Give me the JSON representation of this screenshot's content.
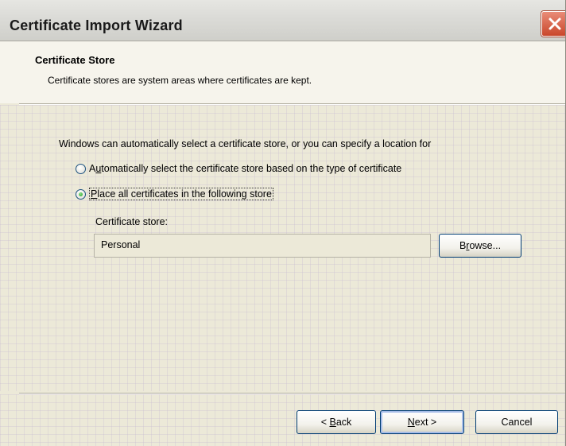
{
  "window": {
    "title": "Certificate Import Wizard",
    "close_icon": "close-x-icon"
  },
  "header": {
    "title": "Certificate Store",
    "description": "Certificate stores are system areas where certificates are kept."
  },
  "main": {
    "instruction": "Windows can automatically select a certificate store, or you can specify a location for",
    "options": [
      {
        "label_prefix": "A",
        "label_mnemonic": "u",
        "label_rest": "tomatically select the certificate store based on the type of certificate",
        "selected": false
      },
      {
        "label_prefix": "",
        "label_mnemonic": "P",
        "label_rest": "lace all certificates in the following store",
        "selected": true
      }
    ],
    "store_label": "Certificate store:",
    "store_value": "Personal",
    "browse_button": {
      "prefix": "B",
      "mnemonic": "r",
      "rest": "owse..."
    }
  },
  "footer": {
    "back_button": {
      "prefix": "< ",
      "mnemonic": "B",
      "rest": "ack"
    },
    "next_button": {
      "prefix": "",
      "mnemonic": "N",
      "rest": "ext >"
    },
    "cancel_button": "Cancel"
  },
  "colors": {
    "window_bg": "#ece9d8",
    "header_bg": "#f6f4ec",
    "button_border": "#003c74",
    "close_button": "#c9472b",
    "radio_selected": "#21a121"
  }
}
